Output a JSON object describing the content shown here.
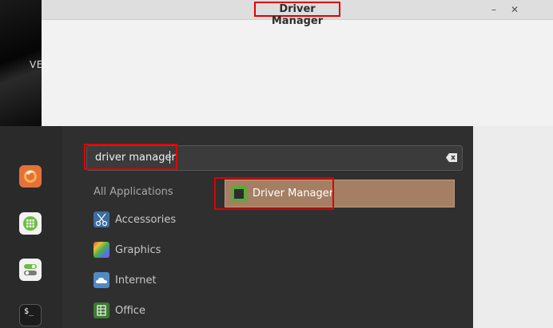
{
  "window": {
    "title": "Driver Manager",
    "minimize": "–",
    "close": "✕"
  },
  "desktop": {
    "partial_text": "VE"
  },
  "menu": {
    "search": {
      "value": "driver manager",
      "clear_icon": "backspace-clear-icon"
    },
    "categories": [
      {
        "label": "All Applications",
        "icon": ""
      },
      {
        "label": "Accessories",
        "icon": "scissors-icon",
        "color": "#4a8fd1"
      },
      {
        "label": "Graphics",
        "icon": "palette-icon",
        "color": "#9a4fc8"
      },
      {
        "label": "Internet",
        "icon": "cloud-icon",
        "color": "#6aa0d8"
      },
      {
        "label": "Office",
        "icon": "spreadsheet-icon",
        "color": "#4a8a3a"
      }
    ],
    "result": {
      "label": "Driver Manager",
      "icon": "chip-icon"
    },
    "favorites": [
      {
        "name": "firefox",
        "icon": "firefox-icon"
      },
      {
        "name": "software-manager",
        "icon": "software-icon"
      },
      {
        "name": "settings",
        "icon": "toggle-icon"
      },
      {
        "name": "terminal",
        "icon": "terminal-icon",
        "label": "$_"
      }
    ]
  },
  "colors": {
    "highlight": "#e00000",
    "result_bg": "#a57f63",
    "menu_bg": "#2f2f2f"
  }
}
